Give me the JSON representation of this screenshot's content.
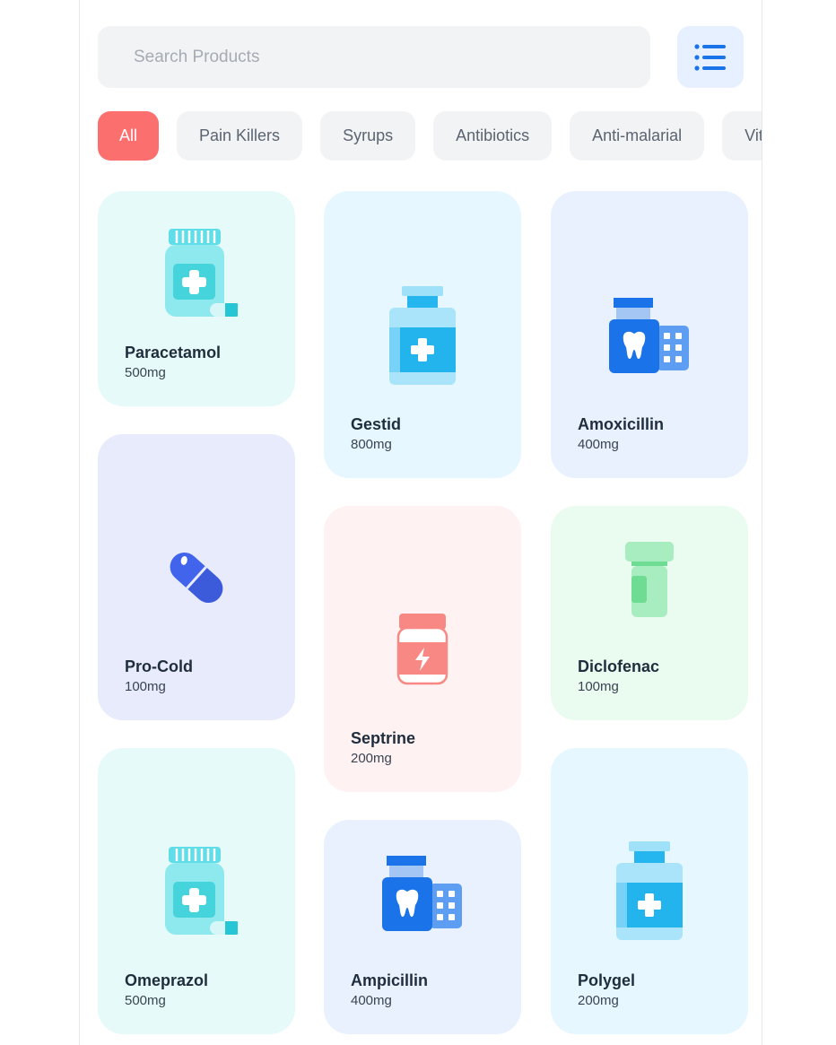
{
  "search": {
    "placeholder": "Search Products"
  },
  "menu": {
    "icon": "list-icon"
  },
  "categories": [
    "All",
    "Pain Killers",
    "Syrups",
    "Antibiotics",
    "Anti-malarial",
    "Vitamins"
  ],
  "products": [
    {
      "name": "Paracetamol",
      "dose": "500mg",
      "icon": "pill-bottle-icon"
    },
    {
      "name": "Gestid",
      "dose": "800mg",
      "icon": "medicine-bottle-icon"
    },
    {
      "name": "Amoxicillin",
      "dose": "400mg",
      "icon": "dental-medicine-icon"
    },
    {
      "name": "Pro-Cold",
      "dose": "100mg",
      "icon": "capsule-icon"
    },
    {
      "name": "Septrine",
      "dose": "200mg",
      "icon": "syrup-jar-icon"
    },
    {
      "name": "Diclofenac",
      "dose": "100mg",
      "icon": "vial-icon"
    },
    {
      "name": "Omeprazol",
      "dose": "500mg",
      "icon": "pill-bottle-icon"
    },
    {
      "name": "Ampicillin",
      "dose": "400mg",
      "icon": "dental-medicine-icon"
    },
    {
      "name": "Polygel",
      "dose": "200mg",
      "icon": "medicine-bottle-icon"
    }
  ],
  "colors": {
    "accent": "#1a73e8",
    "active_chip": "#fb6f6f",
    "chip_bg": "#f2f3f5",
    "card_teal": "#e6fbf9",
    "card_sky": "#e6f7ff",
    "card_blue": "#e8f1fd",
    "card_lavender": "#e8ebfc",
    "card_pink": "#fff2f2",
    "card_mint": "#eafbf0"
  }
}
